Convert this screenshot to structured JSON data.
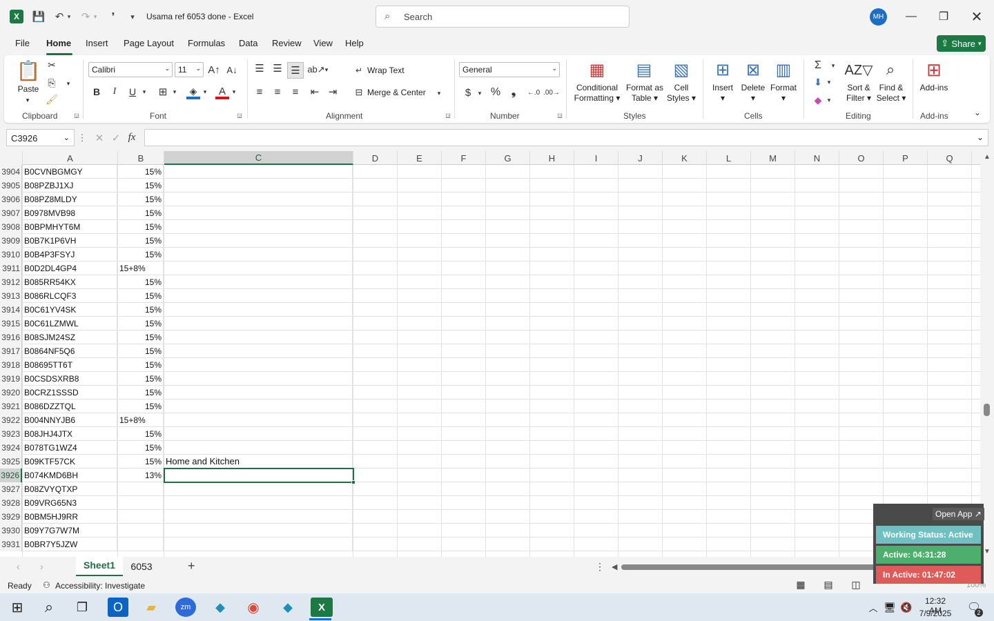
{
  "app": {
    "title": "Usama ref 6053 done  -  Excel",
    "avatar": "MH",
    "search_placeholder": "Search"
  },
  "menu": [
    "File",
    "Home",
    "Insert",
    "Page Layout",
    "Formulas",
    "Data",
    "Review",
    "View",
    "Help"
  ],
  "share": "Share",
  "ribbon": {
    "clipboard": {
      "paste": "Paste",
      "label": "Clipboard"
    },
    "font": {
      "name": "Calibri",
      "size": "11",
      "label": "Font"
    },
    "alignment": {
      "wrap": "Wrap Text",
      "merge": "Merge & Center",
      "label": "Alignment"
    },
    "number": {
      "format": "General",
      "label": "Number"
    },
    "styles": {
      "cond1": "Conditional",
      "cond2": "Formatting",
      "fat1": "Format as",
      "fat2": "Table",
      "cs1": "Cell",
      "cs2": "Styles",
      "label": "Styles"
    },
    "cells": {
      "insert": "Insert",
      "delete": "Delete",
      "format": "Format",
      "label": "Cells"
    },
    "editing": {
      "sort1": "Sort &",
      "sort2": "Filter",
      "find1": "Find &",
      "find2": "Select",
      "label": "Editing"
    },
    "addins": {
      "btn": "Add-ins",
      "label": "Add-ins"
    }
  },
  "namebox": "C3926",
  "columns": [
    "A",
    "B",
    "C",
    "D",
    "E",
    "F",
    "G",
    "H",
    "I",
    "J",
    "K",
    "L",
    "M",
    "N",
    "O",
    "P",
    "Q"
  ],
  "rows": [
    {
      "n": "3904",
      "a": "B0CVNBGMGY",
      "b": "15%",
      "c": ""
    },
    {
      "n": "3905",
      "a": "B08PZBJ1XJ",
      "b": "15%",
      "c": ""
    },
    {
      "n": "3906",
      "a": "B08PZ8MLDY",
      "b": "15%",
      "c": ""
    },
    {
      "n": "3907",
      "a": "B0978MVB98",
      "b": "15%",
      "c": ""
    },
    {
      "n": "3908",
      "a": "B0BPMHYT6M",
      "b": "15%",
      "c": ""
    },
    {
      "n": "3909",
      "a": "B0B7K1P6VH",
      "b": "15%",
      "c": ""
    },
    {
      "n": "3910",
      "a": "B0B4P3FSYJ",
      "b": "15%",
      "c": ""
    },
    {
      "n": "3911",
      "a": "B0D2DL4GP4",
      "b": "15+8%",
      "c": ""
    },
    {
      "n": "3912",
      "a": "B085RR54KX",
      "b": "15%",
      "c": ""
    },
    {
      "n": "3913",
      "a": "B086RLCQF3",
      "b": "15%",
      "c": ""
    },
    {
      "n": "3914",
      "a": "B0C61YV4SK",
      "b": "15%",
      "c": ""
    },
    {
      "n": "3915",
      "a": "B0C61LZMWL",
      "b": "15%",
      "c": ""
    },
    {
      "n": "3916",
      "a": "B08SJM24SZ",
      "b": "15%",
      "c": ""
    },
    {
      "n": "3917",
      "a": "B0864NF5Q6",
      "b": "15%",
      "c": ""
    },
    {
      "n": "3918",
      "a": "B08695TT6T",
      "b": "15%",
      "c": ""
    },
    {
      "n": "3919",
      "a": "B0CSDSXRB8",
      "b": "15%",
      "c": ""
    },
    {
      "n": "3920",
      "a": "B0CRZ1SSSD",
      "b": "15%",
      "c": ""
    },
    {
      "n": "3921",
      "a": "B086DZZTQL",
      "b": "15%",
      "c": ""
    },
    {
      "n": "3922",
      "a": "B004NNYJB6",
      "b": "15+8%",
      "c": ""
    },
    {
      "n": "3923",
      "a": "B08JHJ4JTX",
      "b": "15%",
      "c": ""
    },
    {
      "n": "3924",
      "a": "B078TG1WZ4",
      "b": "15%",
      "c": ""
    },
    {
      "n": "3925",
      "a": "B09KTF57CK",
      "b": "15%",
      "c": "Home and Kitchen"
    },
    {
      "n": "3926",
      "a": "B074KMD6BH",
      "b": "13%",
      "c": ""
    },
    {
      "n": "3927",
      "a": "B08ZVYQTXP",
      "b": "",
      "c": ""
    },
    {
      "n": "3928",
      "a": "B09VRG65N3",
      "b": "",
      "c": ""
    },
    {
      "n": "3929",
      "a": "B0BM5HJ9RR",
      "b": "",
      "c": ""
    },
    {
      "n": "3930",
      "a": "B09Y7G7W7M",
      "b": "",
      "c": ""
    },
    {
      "n": "3931",
      "a": "B0BR7Y5JZW",
      "b": "",
      "c": ""
    }
  ],
  "sheets": [
    "Sheet1",
    "6053"
  ],
  "status": {
    "ready": "Ready",
    "accessibility": "Accessibility: Investigate",
    "zoom": "100%"
  },
  "widget": {
    "open": "Open App ↗",
    "working": "Working Status: Active",
    "active": "Active: 04:31:28",
    "inactive": "In Active: 01:47:02"
  },
  "clock": {
    "time": "12:32 AM",
    "date": "7/9/2025",
    "notif": "2"
  },
  "colors": {
    "excel_green": "#1b7a43",
    "selection": "#1d7044",
    "widget_active": "#4caf6e",
    "widget_inactive": "#e05a5a",
    "widget_status": "#6fc1c1"
  }
}
